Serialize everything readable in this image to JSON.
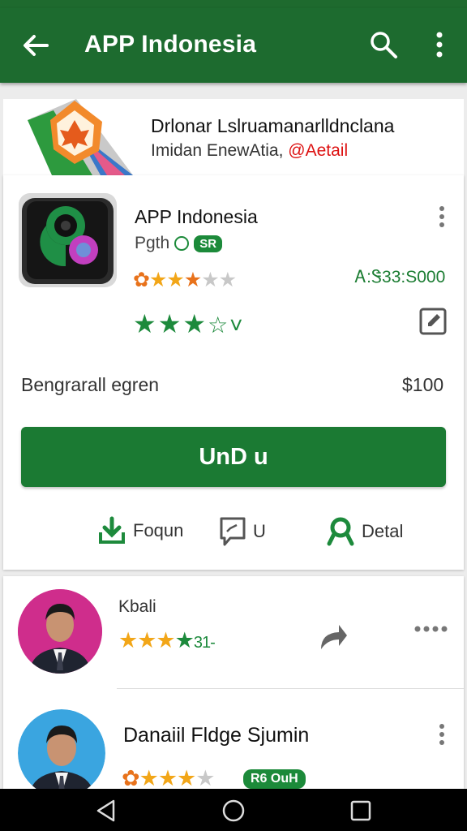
{
  "app_bar": {
    "title": "APP Indonesia",
    "color": "#1d6b2f"
  },
  "banner": {
    "title": "Drlonar Lslruamanarlldnclana",
    "subtitle": "Imidan EnewAtia,",
    "link": "@Aetail"
  },
  "app": {
    "name": "APP Indonesia",
    "tagline": "Pgth",
    "tag_badge": "SR",
    "price_line": "Ꭺ:Ꮥ33:S000",
    "rating_extra": "☆˅",
    "detail_label": "Bengrarall egren",
    "detail_value": "$100",
    "cta_label": "UnD u",
    "actions": [
      {
        "label": "Foqun",
        "icon": "download-icon"
      },
      {
        "label": "U",
        "icon": "comment-icon"
      },
      {
        "label": "Detal",
        "icon": "ribbon-icon"
      }
    ],
    "accent": "#1b7a33"
  },
  "reviews": [
    {
      "name": "Kbali",
      "rating_text": "31-"
    },
    {
      "name": "Danaiil Fldge Sjumin",
      "badge": "R6 OuH"
    }
  ]
}
